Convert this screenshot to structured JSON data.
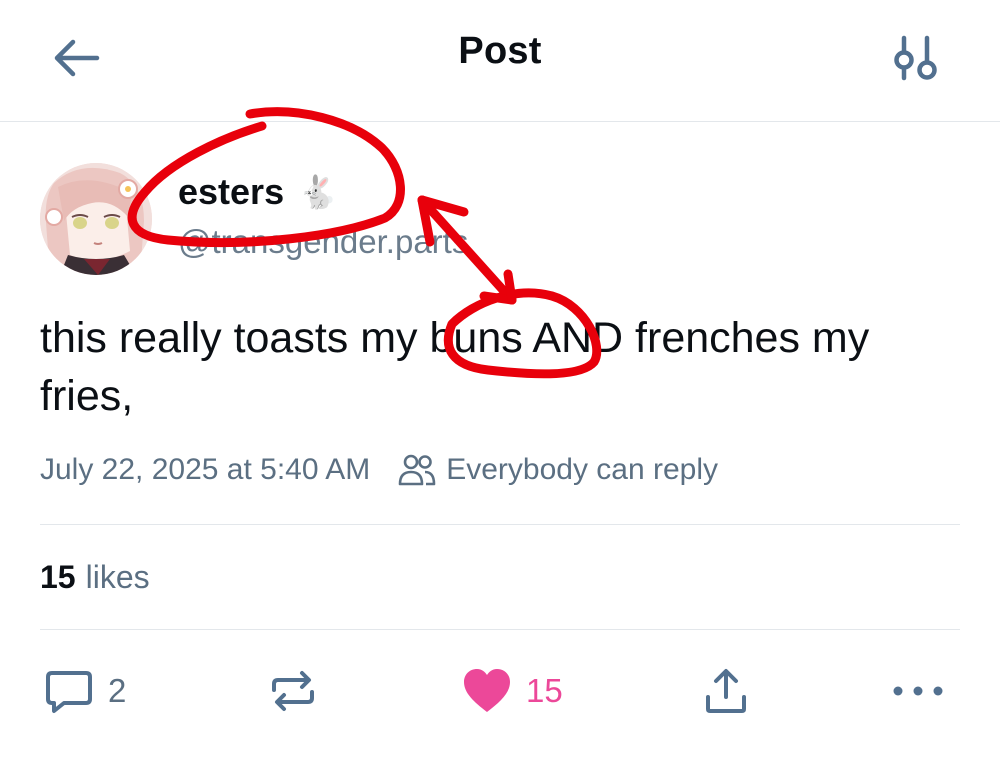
{
  "header": {
    "title": "Post",
    "back_icon": "arrow-left-icon",
    "settings_icon": "sliders-icon"
  },
  "post": {
    "author": {
      "display_name": "esters",
      "emoji": "🐇",
      "handle": "@transgender.parts",
      "avatar": "anime-avatar"
    },
    "text": "this really toasts my buns AND frenches my fries,",
    "timestamp": "July 22, 2025 at 5:40 AM",
    "reply_setting": "Everybody can reply",
    "likes": {
      "count": "15",
      "label": "likes"
    },
    "actions": {
      "reply_count": "2",
      "repost_count": "",
      "like_count": "15"
    }
  },
  "colors": {
    "accent_like": "#ec4899",
    "muted_text": "#5b6f82",
    "annotation_red": "#e8000b",
    "icon_blue_gray": "#52708f"
  },
  "annotation": {
    "description_icon": "red-circle-annotation",
    "shape": "hand-drawn circles with double-headed arrow"
  }
}
